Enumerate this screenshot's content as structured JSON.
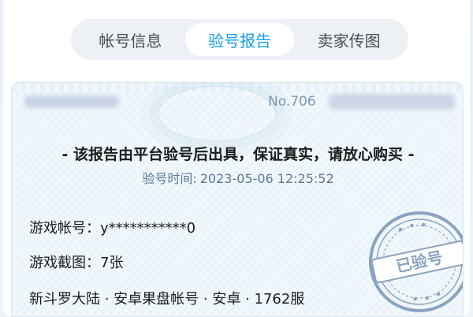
{
  "tabs": [
    {
      "label": "帐号信息",
      "active": false
    },
    {
      "label": "验号报告",
      "active": true
    },
    {
      "label": "卖家传图",
      "active": false
    }
  ],
  "report": {
    "number_prefix": "No.706",
    "headline": "- 该报告由平台验号后出具，保证真实，请放心购买 -",
    "time_label": "验号时间:",
    "time_value": "2023-05-06 12:25:52",
    "account_label": "游戏帐号：",
    "account_value": "y***********0",
    "screenshots_label": "游戏截图：",
    "screenshots_value": "7张",
    "game_line": "新斗罗大陆 · 安卓果盘帐号 · 安卓 · 1762服",
    "stamp_text": "已验号"
  },
  "colors": {
    "accent": "#17a0e8",
    "stamp": "#8aa3bf",
    "muted_blue": "#5d7897"
  }
}
